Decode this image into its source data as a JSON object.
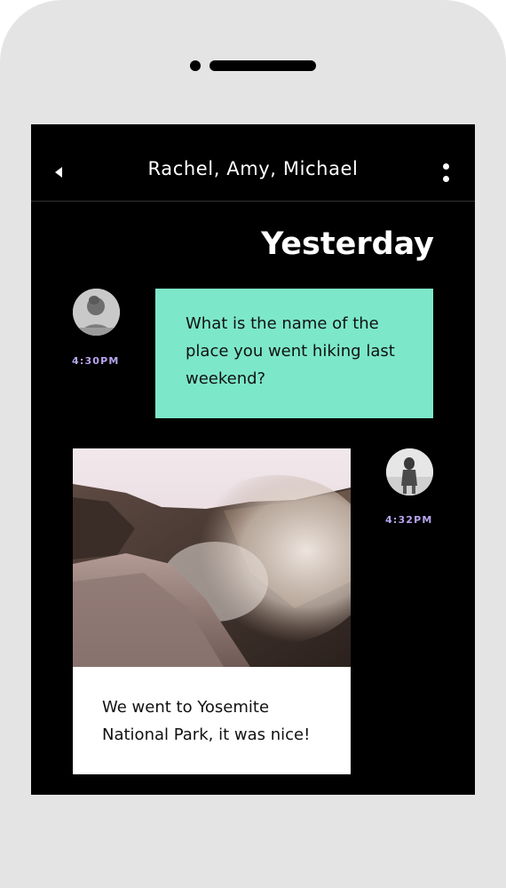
{
  "conversation": {
    "title": "Rachel, Amy, Michael",
    "back_icon": "back-arrow-icon",
    "menu_icon": "more-vertical-icon"
  },
  "day_label": "Yesterday",
  "messages": [
    {
      "sender": "incoming",
      "time": "4:30PM",
      "text": "What is the name of the place you went hiking last weekend?",
      "bubble_color": "#7ce8c9"
    },
    {
      "sender": "outgoing",
      "time": "4:32PM",
      "image": "waterfall-canyon-photo",
      "text": "We went to Yosemite National Park, it was nice!"
    }
  ],
  "colors": {
    "background": "#000000",
    "accent": "#7ce8c9",
    "timestamp": "#b7a6ef"
  }
}
